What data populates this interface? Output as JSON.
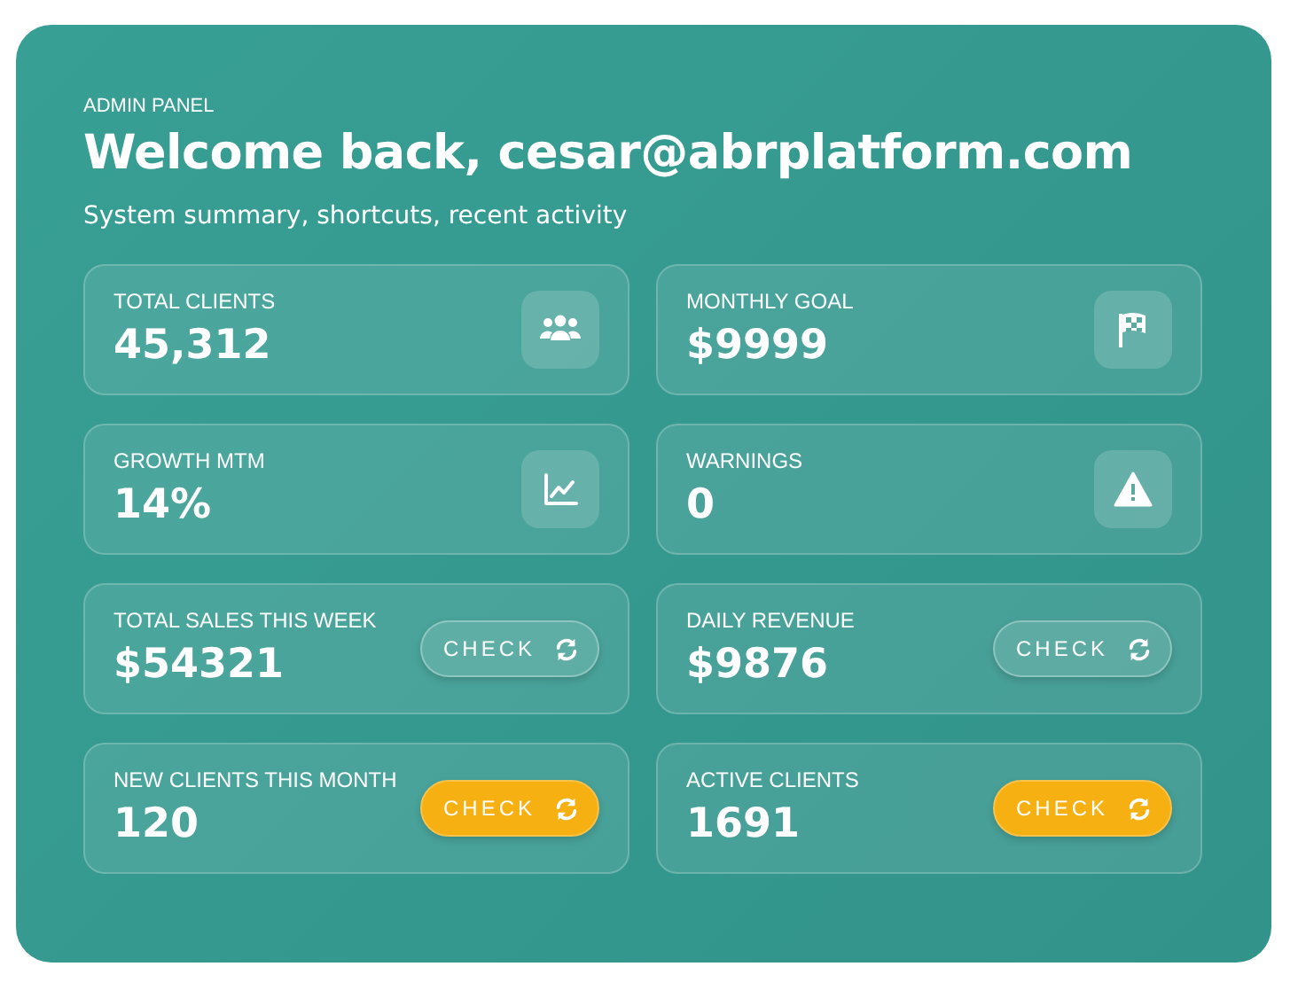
{
  "eyebrow": "ADMIN PANEL",
  "title": "Welcome back, cesar@abrplatform.com",
  "subtitle": "System summary, shortcuts, recent activity",
  "cards": [
    {
      "label": "TOTAL CLIENTS",
      "value": "45,312",
      "kind": "icon"
    },
    {
      "label": "MONTHLY GOAL",
      "value": "$9999",
      "kind": "icon"
    },
    {
      "label": "GROWTH MTM",
      "value": "14%",
      "kind": "icon"
    },
    {
      "label": "WARNINGS",
      "value": "0",
      "kind": "icon"
    },
    {
      "label": "TOTAL SALES THIS WEEK",
      "value": "$54321",
      "kind": "button",
      "button": "CHECK",
      "highlighted": false
    },
    {
      "label": "DAILY REVENUE",
      "value": "$9876",
      "kind": "button",
      "button": "CHECK",
      "highlighted": false
    },
    {
      "label": "NEW CLIENTS THIS MONTH",
      "value": "120",
      "kind": "button",
      "button": "CHECK",
      "highlighted": true
    },
    {
      "label": "ACTIVE CLIENTS",
      "value": "1691",
      "kind": "button",
      "button": "CHECK",
      "highlighted": true
    }
  ]
}
